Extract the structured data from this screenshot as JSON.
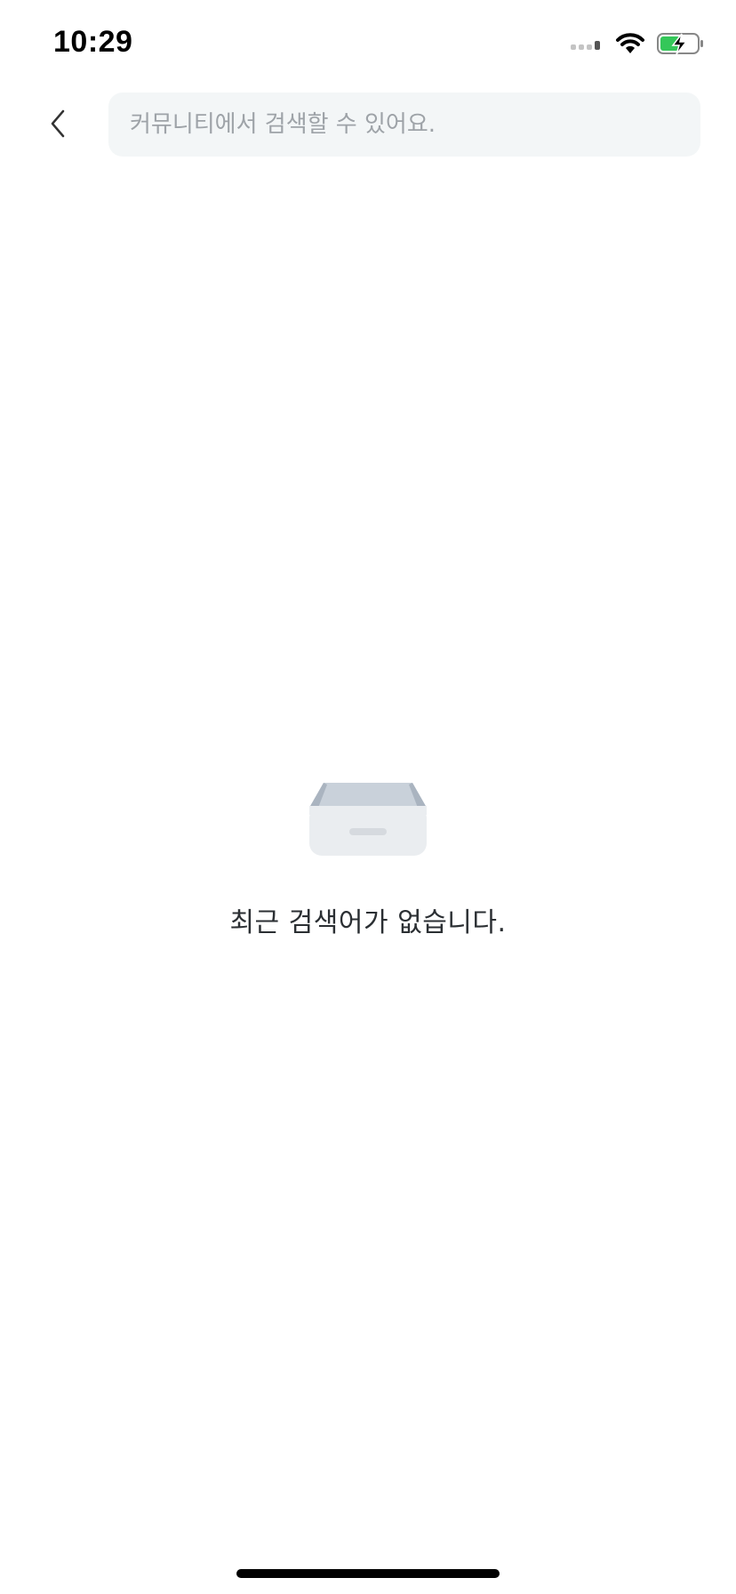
{
  "status_bar": {
    "time": "10:29",
    "icons": [
      "signal-icon",
      "wifi-icon",
      "battery-charging-icon"
    ],
    "battery_color": "#34c759"
  },
  "search": {
    "placeholder": "커뮤니티에서 검색할 수 있어요.",
    "value": "",
    "back_icon": "chevron-left-icon"
  },
  "empty_state": {
    "icon": "empty-drawer-icon",
    "message": "최근 검색어가 없습니다."
  },
  "colors": {
    "search_bg": "#f3f6f7",
    "placeholder": "#9ea3a8",
    "text": "#2b2f33"
  }
}
